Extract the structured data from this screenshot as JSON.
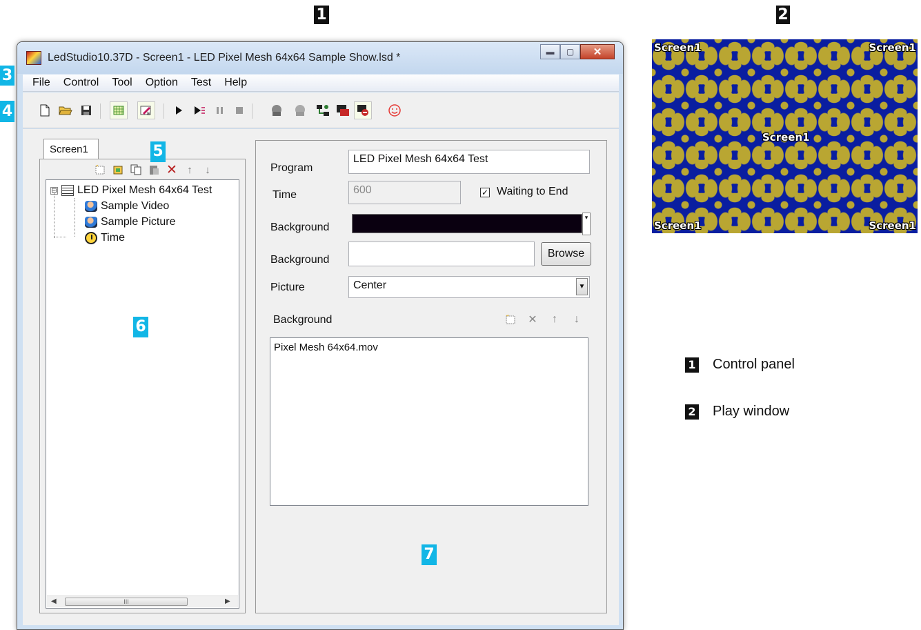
{
  "markers": {
    "m1": "1",
    "m2": "2",
    "m3": "3",
    "m4": "4",
    "m5": "5",
    "m6": "6",
    "m7": "7"
  },
  "window": {
    "title": "LedStudio10.37D - Screen1 - LED Pixel Mesh 64x64 Sample Show.lsd *",
    "buttons": {
      "minimize": "▬",
      "maximize": "▢",
      "close": "✕"
    }
  },
  "menu": [
    "File",
    "Control",
    "Tool",
    "Option",
    "Test",
    "Help"
  ],
  "toolbar": {
    "icons": [
      "new-document-icon",
      "open-folder-icon",
      "save-icon",
      "screen-grid-icon",
      "edit-effect-icon",
      "play-icon",
      "step-play-icon",
      "pause-icon",
      "stop-icon",
      "player-icon",
      "player-disabled-icon",
      "network-icon",
      "display-off-icon",
      "display-record-icon",
      "smiley-icon"
    ]
  },
  "left": {
    "tab": "Screen1",
    "tree": {
      "root": "LED Pixel Mesh 64x64 Test",
      "root_expander": "⊟",
      "children": [
        "Sample Video",
        "Sample Picture",
        "Time"
      ]
    },
    "scroll_thumb": "III"
  },
  "right": {
    "program_label": "Program",
    "program_value": "LED Pixel Mesh 64x64 Test",
    "time_label": "Time",
    "time_value": "600",
    "waiting_label": "Waiting  to End",
    "waiting_checked": "✓",
    "background_label": "Background",
    "background_color": "#0a0010",
    "background2_label": "Background",
    "background2_value": "",
    "browse_label": "Browse",
    "picture_label": "Picture",
    "picture_value": "Center",
    "background_list_label": "Background",
    "background_list": [
      "Pixel Mesh 64x64.mov"
    ]
  },
  "play_window": {
    "top_left": "Screen1",
    "top_right": "Screen1",
    "center": "Screen1",
    "bottom_left": "Screen1",
    "bottom_right": "Screen1"
  },
  "legend": [
    {
      "marker": "1",
      "label": "Control panel"
    },
    {
      "marker": "2",
      "label": "Play window"
    }
  ]
}
